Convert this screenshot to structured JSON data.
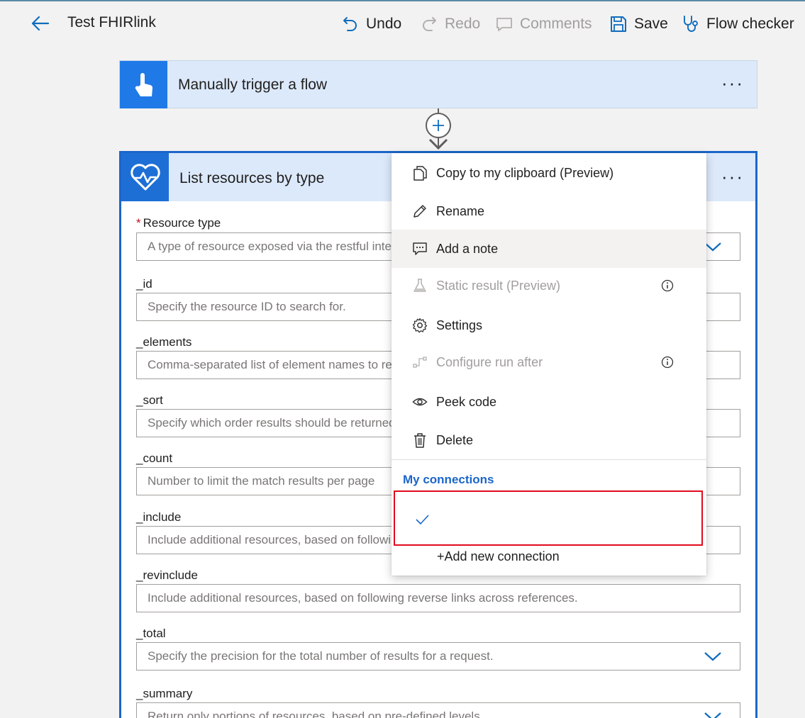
{
  "topbar": {
    "title": "Test FHIRlink",
    "undo_label": "Undo",
    "redo_label": "Redo",
    "comments_label": "Comments",
    "save_label": "Save",
    "flow_checker_label": "Flow checker"
  },
  "trigger": {
    "title": "Manually trigger a flow",
    "more_label": "···"
  },
  "action": {
    "title": "List resources by type",
    "more_label": "···",
    "fields": [
      {
        "label": "Resource type",
        "required": true,
        "placeholder": "A type of resource exposed via the restful interface",
        "dropdown": true
      },
      {
        "label": "_id",
        "placeholder": "Specify the resource ID to search for."
      },
      {
        "label": "_elements",
        "placeholder": "Comma-separated list of element names to return"
      },
      {
        "label": "_sort",
        "placeholder": "Specify which order results should be returned"
      },
      {
        "label": "_count",
        "placeholder": "Number to limit the match results per page"
      },
      {
        "label": "_include",
        "placeholder": "Include additional resources, based on following links"
      },
      {
        "label": "_revinclude",
        "placeholder": "Include additional resources, based on following reverse links across references."
      },
      {
        "label": "_total",
        "placeholder": "Specify the precision for the total number of results for a request.",
        "dropdown": true
      },
      {
        "label": "_summary",
        "placeholder": "Return only portions of resources, based on pre-defined levels.",
        "dropdown": true
      }
    ]
  },
  "menu": {
    "items": [
      {
        "label": "Copy to my clipboard (Preview)",
        "icon": "copy-icon"
      },
      {
        "label": "Rename",
        "icon": "pencil-icon"
      },
      {
        "label": "Add a note",
        "icon": "note-icon"
      },
      {
        "label": "Static result (Preview)",
        "icon": "flask-icon"
      },
      {
        "label": "Settings",
        "icon": "gear-icon"
      },
      {
        "label": "Configure run after",
        "icon": "run-after-icon"
      },
      {
        "label": "Peek code",
        "icon": "eye-icon"
      },
      {
        "label": "Delete",
        "icon": "trash-icon"
      }
    ],
    "connections_heading": "My connections",
    "add_connection_label": "+Add new connection"
  },
  "colors": {
    "accent": "#1b66c9",
    "trigger_bg": "#dce9fb",
    "highlight_border": "#e00b1c"
  }
}
